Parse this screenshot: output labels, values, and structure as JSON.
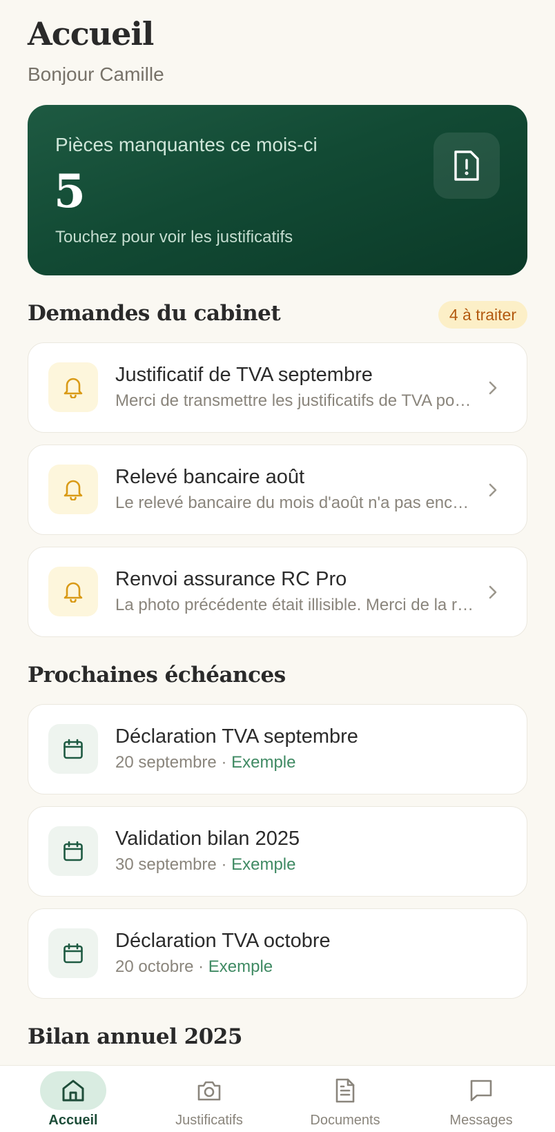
{
  "header": {
    "title": "Accueil",
    "greeting": "Bonjour Camille"
  },
  "missing": {
    "label": "Pièces manquantes ce mois-ci",
    "count": "5",
    "hint": "Touchez pour voir les justificatifs",
    "icon": "file-alert-icon"
  },
  "requests": {
    "title": "Demandes du cabinet",
    "badge": "4 à traiter",
    "items": [
      {
        "title": "Justificatif de TVA septembre",
        "subtitle": "Merci de transmettre les justificatifs de TVA pour septembre",
        "icon": "bell-icon"
      },
      {
        "title": "Relevé bancaire août",
        "subtitle": "Le relevé bancaire du mois d'août n'a pas encore été reçu",
        "icon": "bell-icon"
      },
      {
        "title": "Renvoi assurance RC Pro",
        "subtitle": "La photo précédente était illisible. Merci de la renvoyer",
        "icon": "bell-icon"
      }
    ]
  },
  "deadlines": {
    "title": "Prochaines échéances",
    "separator": "·",
    "items": [
      {
        "title": "Déclaration TVA septembre",
        "date": "20 septembre",
        "tag": "Exemple",
        "icon": "calendar-icon"
      },
      {
        "title": "Validation bilan 2025",
        "date": "30 septembre",
        "tag": "Exemple",
        "icon": "calendar-icon"
      },
      {
        "title": "Déclaration TVA octobre",
        "date": "20 octobre",
        "tag": "Exemple",
        "icon": "calendar-icon"
      }
    ]
  },
  "annual": {
    "title": "Bilan annuel 2025"
  },
  "nav": {
    "items": [
      {
        "label": "Accueil",
        "icon": "home-icon",
        "active": true
      },
      {
        "label": "Justificatifs",
        "icon": "camera-icon",
        "active": false
      },
      {
        "label": "Documents",
        "icon": "document-icon",
        "active": false
      },
      {
        "label": "Messages",
        "icon": "message-icon",
        "active": false
      }
    ]
  },
  "colors": {
    "background": "#faf8f2",
    "primary": "#1e5a42",
    "accent_green": "#3f8a63",
    "badge_bg": "#fcefc7",
    "badge_text": "#b35a10",
    "bell": "#d99a16"
  }
}
